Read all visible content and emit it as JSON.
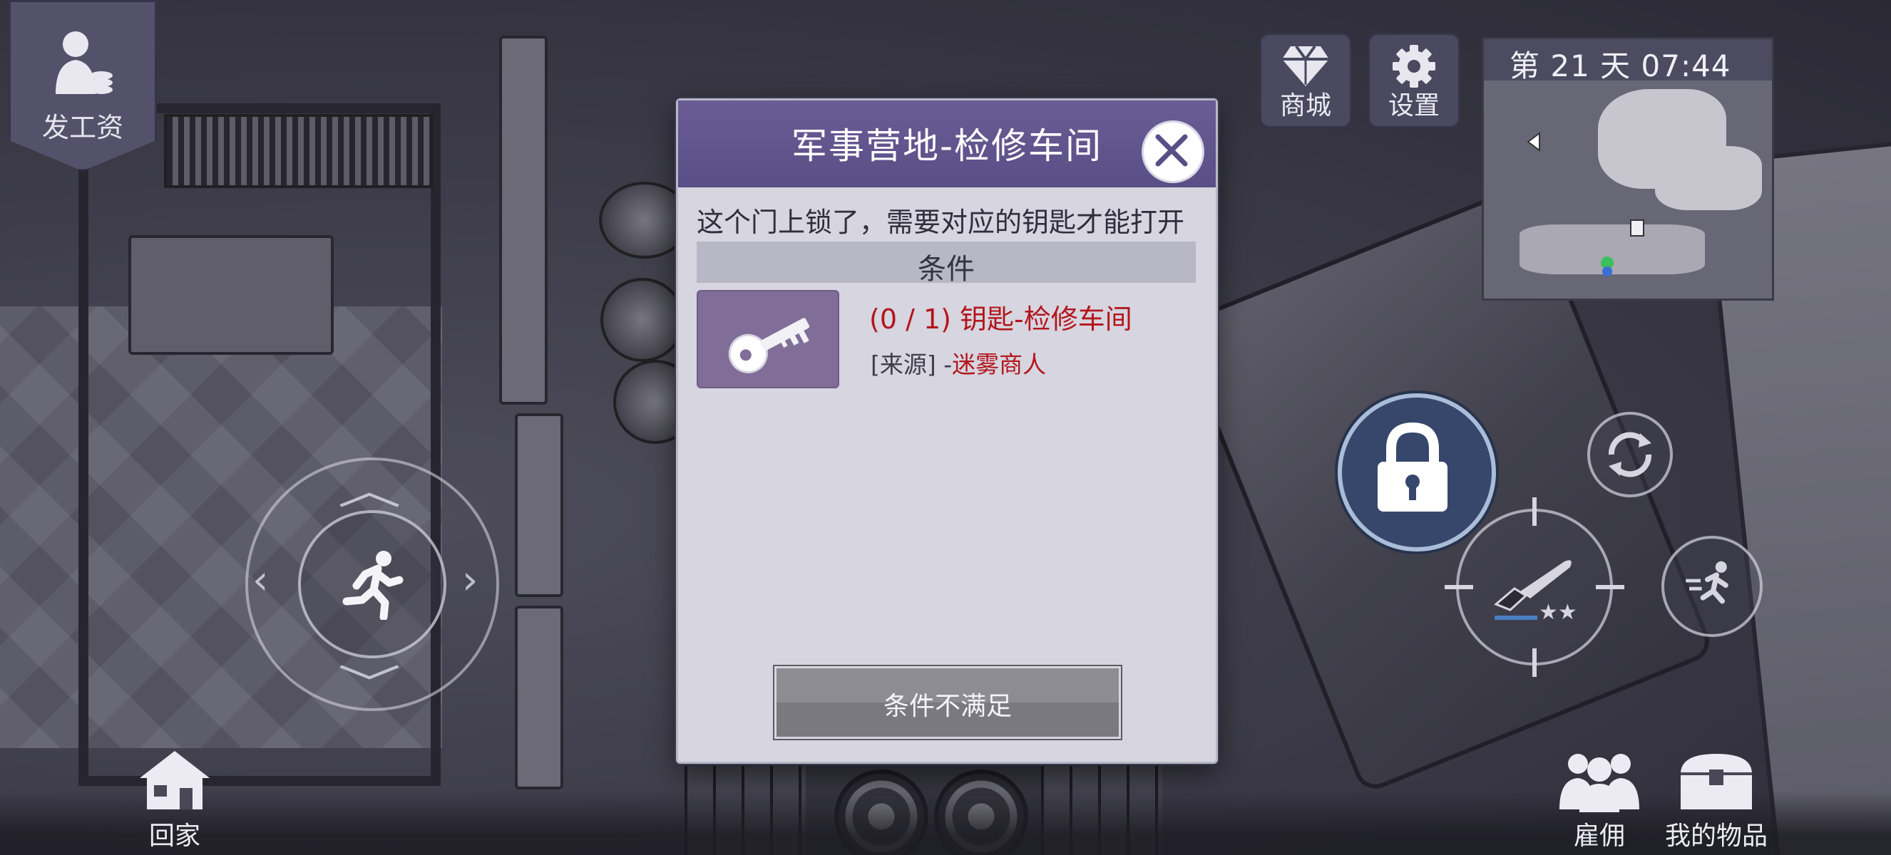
{
  "hud": {
    "pay_label": "发工资",
    "shop_label": "商城",
    "settings_label": "设置",
    "day_time": "第 21 天  07:44",
    "home_label": "回家",
    "hire_label": "雇佣",
    "items_label": "我的物品"
  },
  "dialog": {
    "title": "军事营地-检修车间",
    "description": "这个门上锁了，需要对应的钥匙才能打开",
    "conditions_header": "条件",
    "requirement": "(0 / 1) 钥匙-检修车间",
    "source_label": "[来源] -",
    "source_value": "迷雾商人",
    "button_label": "条件不满足"
  },
  "icons": {
    "close": "close-icon",
    "key": "key-icon",
    "lock": "lock-icon",
    "diamond": "diamond-icon",
    "gear": "gear-icon",
    "runner": "runner-icon",
    "knife": "knife-icon",
    "house": "house-icon",
    "people": "people-icon",
    "chest": "chest-icon"
  },
  "colors": {
    "dialog_header": "#5a4e86",
    "requirement_text": "#b3151b",
    "lock_button": "#37476b"
  }
}
